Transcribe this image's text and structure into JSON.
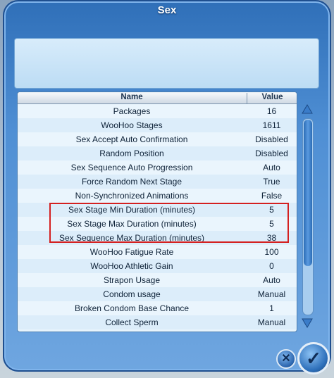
{
  "dialog": {
    "title": "Sex"
  },
  "table": {
    "headers": {
      "name": "Name",
      "value": "Value"
    },
    "rows": [
      {
        "name": "Packages",
        "value": "16"
      },
      {
        "name": "WooHoo Stages",
        "value": "1611"
      },
      {
        "name": "Sex Accept Auto Confirmation",
        "value": "Disabled"
      },
      {
        "name": "Random Position",
        "value": "Disabled"
      },
      {
        "name": "Sex Sequence Auto Progression",
        "value": "Auto"
      },
      {
        "name": "Force Random Next Stage",
        "value": "True"
      },
      {
        "name": "Non-Synchronized Animations",
        "value": "False"
      },
      {
        "name": "Sex Stage Min Duration (minutes)",
        "value": "5"
      },
      {
        "name": "Sex Stage Max Duration (minutes)",
        "value": "5"
      },
      {
        "name": "Sex Sequence Max Duration (minutes)",
        "value": "38"
      },
      {
        "name": "WooHoo Fatigue Rate",
        "value": "100"
      },
      {
        "name": "WooHoo Athletic Gain",
        "value": "0"
      },
      {
        "name": "Strapon Usage",
        "value": "Auto"
      },
      {
        "name": "Condom usage",
        "value": "Manual"
      },
      {
        "name": "Broken Condom Base Chance",
        "value": "1"
      },
      {
        "name": "Collect Sperm",
        "value": "Manual"
      }
    ]
  },
  "controls": {
    "scroll_up_icon": "triangle-up",
    "scroll_down_icon": "triangle-down",
    "cancel_icon": "x",
    "ok_icon": "checkmark"
  },
  "colors": {
    "highlight": "#d42020",
    "dialog_blue": "#4f8fd4"
  }
}
